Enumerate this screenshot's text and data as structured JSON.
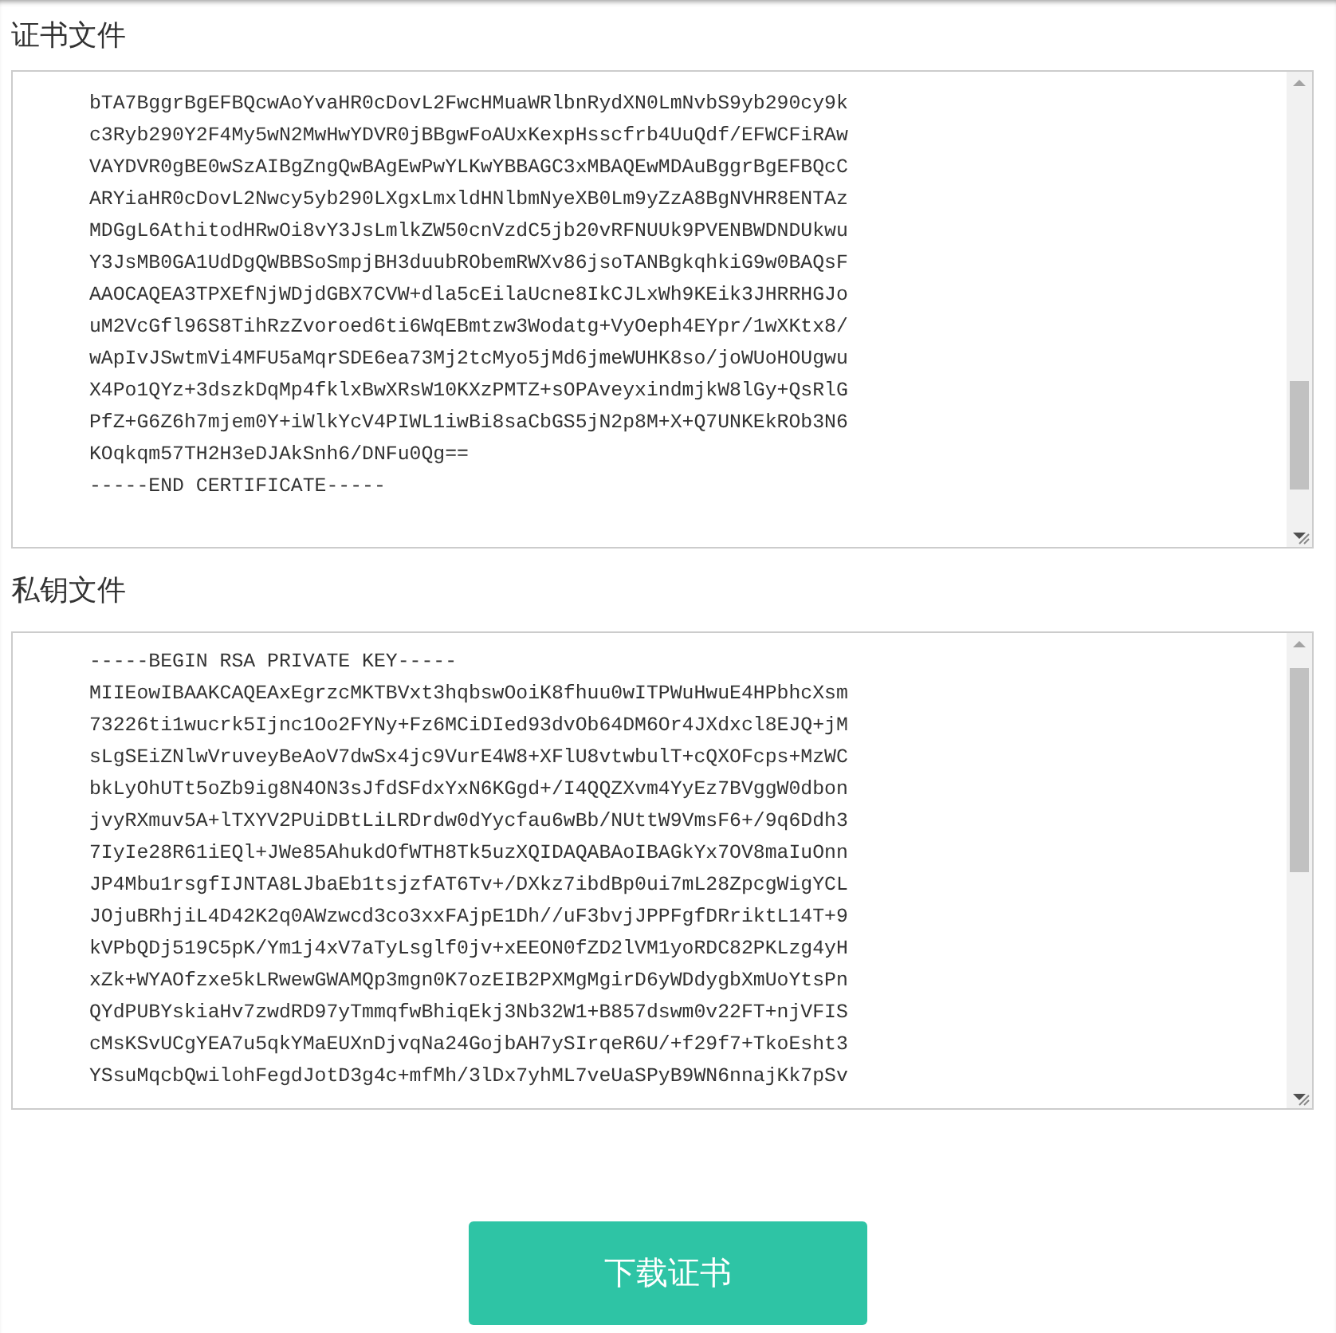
{
  "sections": [
    {
      "label": "证书文件",
      "lines": [
        "bTA7BggrBgEFBQcwAoYvaHR0cDovL2FwcHMuaWRlbnRydXN0LmNvbS9yb290cy9k",
        "c3Ryb290Y2F4My5wN2MwHwYDVR0jBBgwFoAUxKexpHsscfrb4UuQdf/EFWCFiRAw",
        "VAYDVR0gBE0wSzAIBgZngQwBAgEwPwYLKwYBBAGC3xMBAQEwMDAuBggrBgEFBQcC",
        "ARYiaHR0cDovL2Nwcy5yb290LXgxLmxldHNlbmNyeXB0Lm9yZzA8BgNVHR8ENTAz",
        "MDGgL6AthitodHRwOi8vY3JsLmlkZW50cnVzdC5jb20vRFNUUk9PVENBWDNDUkwu",
        "Y3JsMB0GA1UdDgQWBBSoSmpjBH3duubRObemRWXv86jsoTANBgkqhkiG9w0BAQsF",
        "AAOCAQEA3TPXEfNjWDjdGBX7CVW+dla5cEilaUcne8IkCJLxWh9KEik3JHRRHGJo",
        "uM2VcGfl96S8TihRzZvoroed6ti6WqEBmtzw3Wodatg+VyOeph4EYpr/1wXKtx8/",
        "wApIvJSwtmVi4MFU5aMqrSDE6ea73Mj2tcMyo5jMd6jmeWUHK8so/joWUoHOUgwu",
        "X4Po1QYz+3dszkDqMp4fklxBwXRsW10KXzPMTZ+sOPAveyxindmjkW8lGy+QsRlG",
        "PfZ+G6Z6h7mjem0Y+iWlkYcV4PIWL1iwBi8saCbGS5jN2p8M+X+Q7UNKEkROb3N6",
        "KOqkqm57TH2H3eDJAkSnh6/DNFu0Qg==",
        "-----END CERTIFICATE-----"
      ]
    },
    {
      "label": "私钥文件",
      "lines": [
        "-----BEGIN RSA PRIVATE KEY-----",
        "MIIEowIBAAKCAQEAxEgrzcMKTBVxt3hqbswOoiK8fhuu0wITPWuHwuE4HPbhcXsm",
        "73226ti1wucrk5Ijnc1Oo2FYNy+Fz6MCiDIed93dvOb64DM6Or4JXdxcl8EJQ+jM",
        "sLgSEiZNlwVruveyBeAoV7dwSx4jc9VurE4W8+XFlU8vtwbulT+cQXOFcps+MzWC",
        "bkLyOhUTt5oZb9ig8N4ON3sJfdSFdxYxN6KGgd+/I4QQZXvm4YyEz7BVggW0dbon",
        "jvyRXmuv5A+lTXYV2PUiDBtLiLRDrdw0dYycfau6wBb/NUttW9VmsF6+/9q6Ddh3",
        "7IyIe28R61iEQl+JWe85AhukdOfWTH8Tk5uzXQIDAQABAoIBAGkYx7OV8maIuOnn",
        "JP4Mbu1rsgfIJNTA8LJbaEb1tsjzfAT6Tv+/DXkz7ibdBp0ui7mL28ZpcgWigYCL",
        "JOjuBRhjiL4D42K2q0AWzwcd3co3xxFAjpE1Dh//uF3bvjJPPFgfDRriktL14T+9",
        "kVPbQDj519C5pK/Ym1j4xV7aTyLsglf0jv+xEEON0fZD2lVM1yoRDC82PKLzg4yH",
        "xZk+WYAOfzxe5kLRwewGWAMQp3mgn0K7ozEIB2PXMgMgirD6yWDdygbXmUoYtsPn",
        "QYdPUBYskiaHv7zwdRD97yTmmqfwBhiqEkj3Nb32W1+B857dswm0v22FT+njVFIS",
        "cMsKSvUCgYEA7u5qkYMaEUXnDjvqNa24GojbAH7ySIrqeR6U/+f29f7+TkoEsht3",
        "YSsuMqcbQwilohFegdJotD3g4c+mfMh/3lDx7yhML7veUaSPyB9WN6nnajKk7pSv"
      ]
    }
  ],
  "button": "下载证书"
}
